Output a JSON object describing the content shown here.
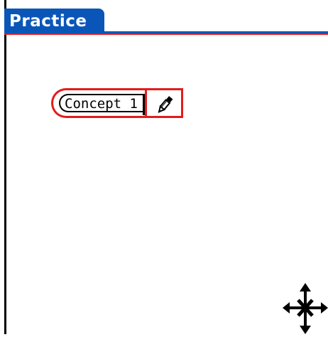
{
  "app": {
    "title": "Practice"
  },
  "canvas": {
    "nodes": [
      {
        "label": "Concept 1"
      }
    ]
  },
  "icons": {
    "edit": "pencil-icon",
    "move": "move-arrows-icon"
  },
  "colors": {
    "title_bar": "#0a56b8",
    "selection": "#e21c1c",
    "text": "#000000",
    "background": "#ffffff"
  }
}
